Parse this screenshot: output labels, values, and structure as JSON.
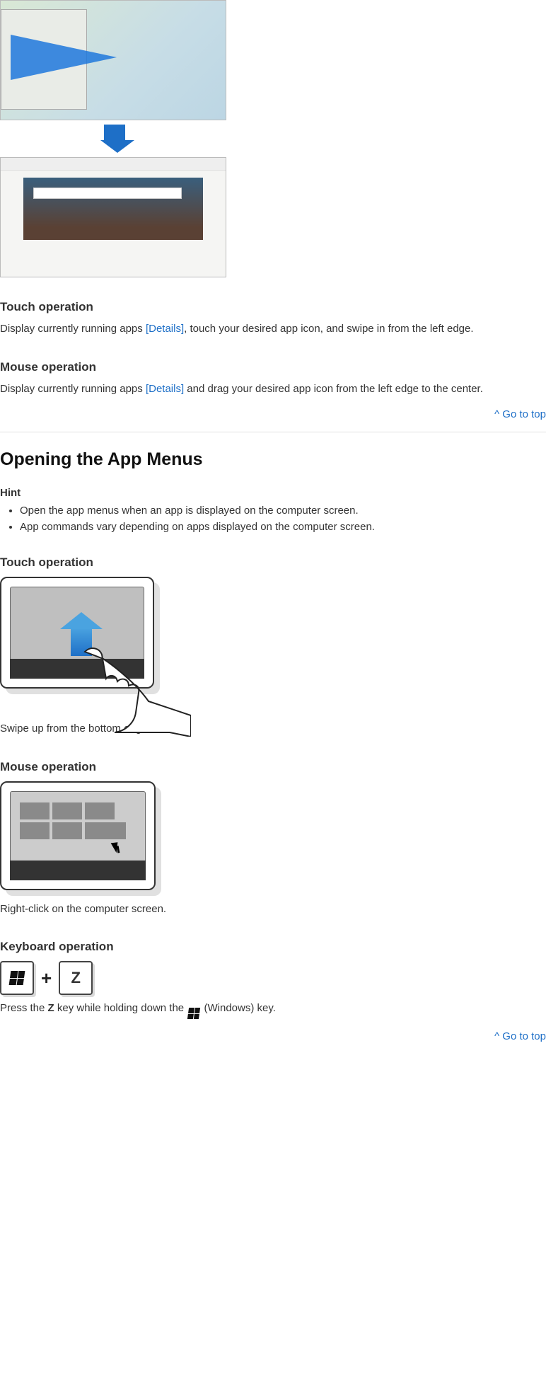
{
  "go_to_top": "^ Go to top",
  "details_link": "[Details]",
  "section1": {
    "touch_heading": "Touch operation",
    "touch_p1a": "Display currently running apps ",
    "touch_p1b": ", touch your desired app icon, and swipe in from the left edge.",
    "mouse_heading": "Mouse operation",
    "mouse_p1a": "Display currently running apps ",
    "mouse_p1b": " and drag your desired app icon from the left edge to the center."
  },
  "section2": {
    "heading": "Opening the App Menus",
    "hint_label": "Hint",
    "hints": [
      "Open the app menus when an app is displayed on the computer screen.",
      "App commands vary depending on apps displayed on the computer screen."
    ],
    "touch_heading": "Touch operation",
    "touch_caption": "Swipe up from the bottom edge.",
    "mouse_heading": "Mouse operation",
    "mouse_caption": "Right-click on the computer screen.",
    "keyboard_heading": "Keyboard operation",
    "key_z": "Z",
    "plus": "+",
    "kb_p1a": "Press the ",
    "kb_p1b": " key while holding down the ",
    "kb_p1c": " (Windows) key.",
    "kb_bold_key": "Z"
  }
}
